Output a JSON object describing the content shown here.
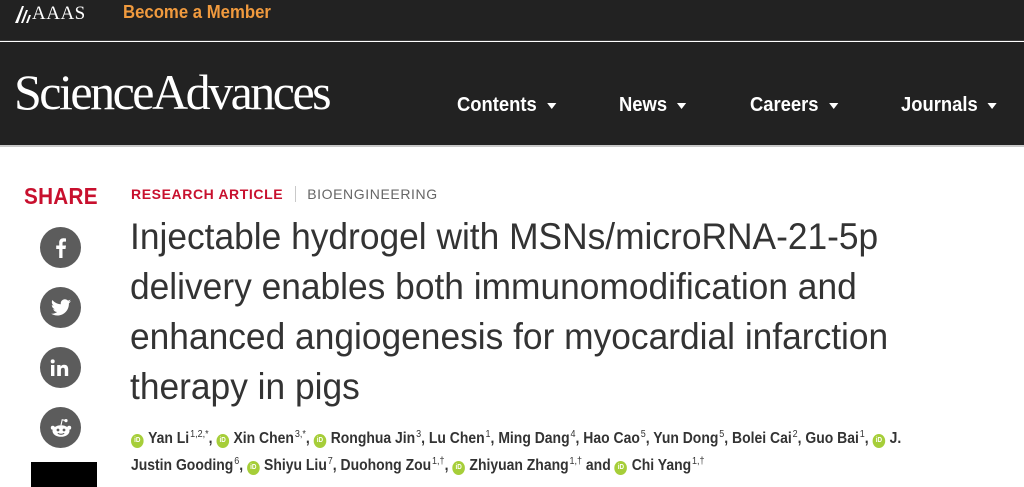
{
  "topbar": {
    "aaas_label": "AAAS",
    "member_link": "Become a Member",
    "accent_color": "#f09a3e"
  },
  "navbar": {
    "brand": "ScienceAdvances",
    "items": [
      {
        "label": "Contents"
      },
      {
        "label": "News"
      },
      {
        "label": "Careers"
      },
      {
        "label": "Journals"
      }
    ]
  },
  "share": {
    "label": "SHARE",
    "buttons": [
      {
        "icon": "facebook-icon"
      },
      {
        "icon": "twitter-icon"
      },
      {
        "icon": "linkedin-icon"
      },
      {
        "icon": "reddit-icon"
      }
    ]
  },
  "article": {
    "type": "RESEARCH ARTICLE",
    "field": "BIOENGINEERING",
    "title_lines": [
      "Injectable hydrogel with MSNs/microRNA-21-5p",
      "delivery enables both immunomodification and",
      "enhanced angiogenesis for myocardial infarction",
      "therapy in pigs"
    ],
    "orcid_label": "iD",
    "authors": [
      {
        "name": "Yan Li",
        "aff": "1,2,*",
        "orcid": true
      },
      {
        "name": "Xin Chen",
        "aff": "3,*",
        "orcid": true
      },
      {
        "name": "Ronghua Jin",
        "aff": "3",
        "orcid": true
      },
      {
        "name": "Lu Chen",
        "aff": "1",
        "orcid": false
      },
      {
        "name": "Ming Dang",
        "aff": "4",
        "orcid": false
      },
      {
        "name": "Hao Cao",
        "aff": "5",
        "orcid": false
      },
      {
        "name": "Yun Dong",
        "aff": "5",
        "orcid": false
      },
      {
        "name": "Bolei Cai",
        "aff": "2",
        "orcid": false
      },
      {
        "name": "Guo Bai",
        "aff": "1",
        "orcid": false
      },
      {
        "name_line1": "J.",
        "name_line2": "Justin Gooding",
        "aff": "6",
        "orcid": true
      },
      {
        "name": "Shiyu Liu",
        "aff": "7",
        "orcid": true
      },
      {
        "name": "Duohong Zou",
        "aff": "1,†",
        "orcid": false
      },
      {
        "name": "Zhiyuan Zhang",
        "aff": "1,†",
        "orcid": true
      },
      {
        "name": "Chi Yang",
        "aff": "1,†",
        "orcid": true
      }
    ],
    "and_word": "and",
    "comma": ","
  },
  "colors": {
    "header_bg": "#222222",
    "accent_red": "#c8102e",
    "orcid_green": "#a6ce39"
  }
}
